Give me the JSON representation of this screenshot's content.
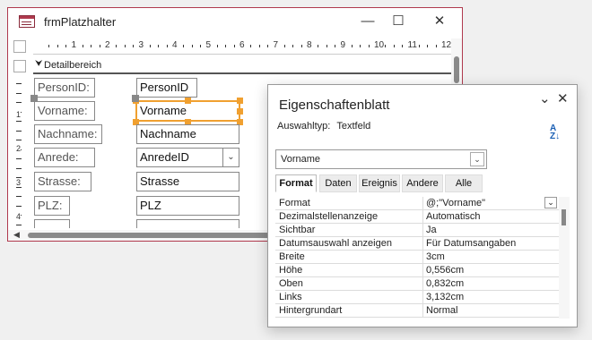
{
  "window": {
    "title": "frmPlatzhalter",
    "minimize": "—",
    "maximize": "☐",
    "close": "✕"
  },
  "ruler": {
    "numbers": [
      "1",
      "2",
      "3",
      "4",
      "5",
      "6",
      "7",
      "8",
      "9",
      "10",
      "11",
      "12"
    ],
    "left_numbers": [
      "1",
      "2",
      "3",
      "4"
    ]
  },
  "section": {
    "label": "Detailbereich",
    "icon": "chevron-down-icon"
  },
  "form": {
    "labels": [
      "PersonID:",
      "Vorname:",
      "Nachname:",
      "Anrede:",
      "Strasse:",
      "PLZ:"
    ],
    "fields": [
      "PersonID",
      "Vorname",
      "Nachname",
      "AnredeID",
      "Strasse",
      "PLZ"
    ],
    "combo_arrow": "⌄"
  },
  "panel": {
    "title": "Eigenschaftenblatt",
    "collapse": "⌄",
    "close": "✕",
    "selection_type_label": "Auswahltyp:",
    "selection_type_value": "Textfeld",
    "sort_icon": "sort-az-icon",
    "sort_top": "A",
    "sort_bottom": "Z",
    "object_combo": "Vorname",
    "tabs": [
      "Format",
      "Daten",
      "Ereignis",
      "Andere",
      "Alle"
    ],
    "active_tab": "Format",
    "properties": [
      {
        "name": "Format",
        "value": "@;\"Vorname\""
      },
      {
        "name": "Dezimalstellenanzeige",
        "value": "Automatisch"
      },
      {
        "name": "Sichtbar",
        "value": "Ja"
      },
      {
        "name": "Datumsauswahl anzeigen",
        "value": "Für Datumsangaben"
      },
      {
        "name": "Breite",
        "value": "3cm"
      },
      {
        "name": "Höhe",
        "value": "0,556cm"
      },
      {
        "name": "Oben",
        "value": "0,832cm"
      },
      {
        "name": "Links",
        "value": "3,132cm"
      },
      {
        "name": "Hintergrundart",
        "value": "Normal"
      }
    ]
  },
  "colors": {
    "selection": "#f0a030",
    "window_border": "#b03a4e",
    "accent": "#1a5fb4"
  }
}
